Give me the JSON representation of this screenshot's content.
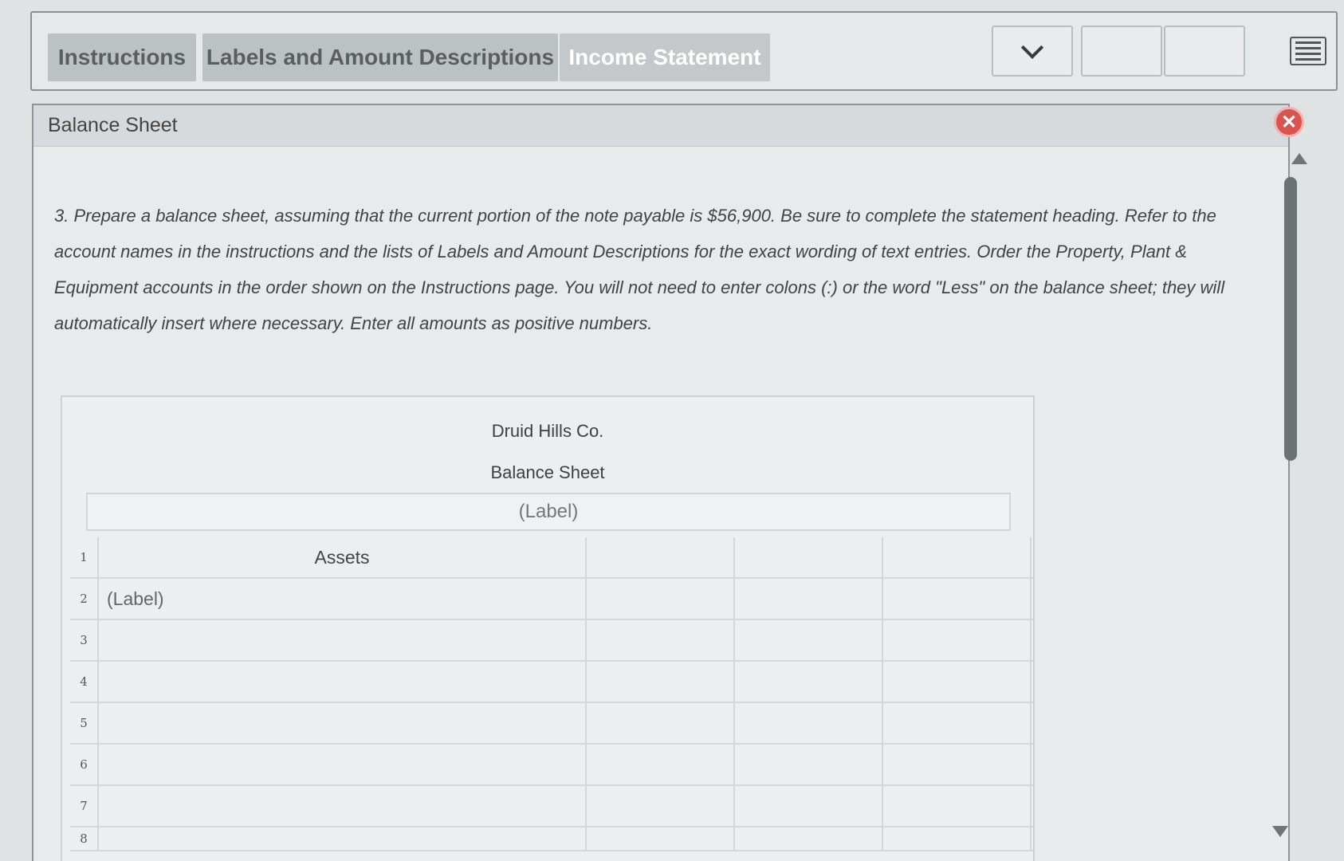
{
  "tabs": [
    {
      "label": "Instructions"
    },
    {
      "label": "Labels and Amount Descriptions"
    },
    {
      "label": "Income Statement"
    }
  ],
  "panel": {
    "title": "Balance Sheet",
    "instructions": "3. Prepare a balance sheet, assuming that the current portion of the note payable is $56,900. Be sure to complete the statement heading. Refer to the account names in the instructions and the lists of Labels and Amount Descriptions for the exact wording of text entries. Order the Property, Plant & Equipment accounts in the order shown on the Instructions page. You will not need to enter colons (:) or the word \"Less\" on the balance sheet; they will automatically insert where necessary. Enter all amounts as positive numbers."
  },
  "sheet": {
    "company": "Druid Hills Co.",
    "statement": "Balance Sheet",
    "date_placeholder": "(Label)",
    "rows": [
      {
        "num": "1",
        "label": "Assets"
      },
      {
        "num": "2",
        "label": "(Label)"
      },
      {
        "num": "3",
        "label": ""
      },
      {
        "num": "4",
        "label": ""
      },
      {
        "num": "5",
        "label": ""
      },
      {
        "num": "6",
        "label": ""
      },
      {
        "num": "7",
        "label": ""
      },
      {
        "num": "8",
        "label": ""
      }
    ]
  },
  "icons": {
    "close": "close-icon",
    "dropdown": "chevron-down-icon",
    "menu": "menu-icon"
  },
  "colors": {
    "close_button": "#d9534f",
    "tab_background": "#bcc1c4"
  }
}
